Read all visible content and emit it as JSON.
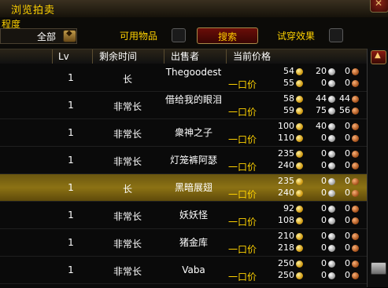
{
  "window": {
    "title": "浏览拍卖",
    "close_icon": "✕"
  },
  "filters": {
    "quality_label": "程度",
    "quality_value": "全部",
    "usable_label": "可用物品",
    "search_label": "搜索",
    "preview_label": "试穿效果"
  },
  "table": {
    "headers": {
      "lv": "Lv",
      "time": "剩余时间",
      "seller": "出售者",
      "price": "当前价格"
    },
    "buyout_label": "一口价",
    "rows": [
      {
        "lv": "1",
        "time": "长",
        "seller": "Thegoodest",
        "bid": [
          "54",
          "20",
          "0"
        ],
        "buyout": [
          "55",
          "0",
          "0"
        ],
        "highlight": false
      },
      {
        "lv": "1",
        "time": "非常长",
        "seller": "借给我的眼泪",
        "bid": [
          "58",
          "44",
          "44"
        ],
        "buyout": [
          "59",
          "75",
          "56"
        ],
        "highlight": false
      },
      {
        "lv": "1",
        "time": "非常长",
        "seller": "衆神之子",
        "bid": [
          "100",
          "40",
          "0"
        ],
        "buyout": [
          "110",
          "0",
          "0"
        ],
        "highlight": false
      },
      {
        "lv": "1",
        "time": "非常长",
        "seller": "灯笼裤阿瑟",
        "bid": [
          "235",
          "0",
          "0"
        ],
        "buyout": [
          "240",
          "0",
          "0"
        ],
        "highlight": false
      },
      {
        "lv": "1",
        "time": "长",
        "seller": "黑暗展翅",
        "bid": [
          "235",
          "0",
          "0"
        ],
        "buyout": [
          "240",
          "0",
          "0"
        ],
        "highlight": true
      },
      {
        "lv": "1",
        "time": "非常长",
        "seller": "妖妖怪",
        "bid": [
          "92",
          "0",
          "0"
        ],
        "buyout": [
          "108",
          "0",
          "0"
        ],
        "highlight": false
      },
      {
        "lv": "1",
        "time": "非常长",
        "seller": "猪金库",
        "bid": [
          "210",
          "0",
          "0"
        ],
        "buyout": [
          "218",
          "0",
          "0"
        ],
        "highlight": false
      },
      {
        "lv": "1",
        "time": "非常长",
        "seller": "Vaba",
        "bid": [
          "250",
          "0",
          "0"
        ],
        "buyout": [
          "250",
          "0",
          "0"
        ],
        "highlight": false
      }
    ]
  },
  "scrollbar": {
    "up_icon": "▲"
  }
}
